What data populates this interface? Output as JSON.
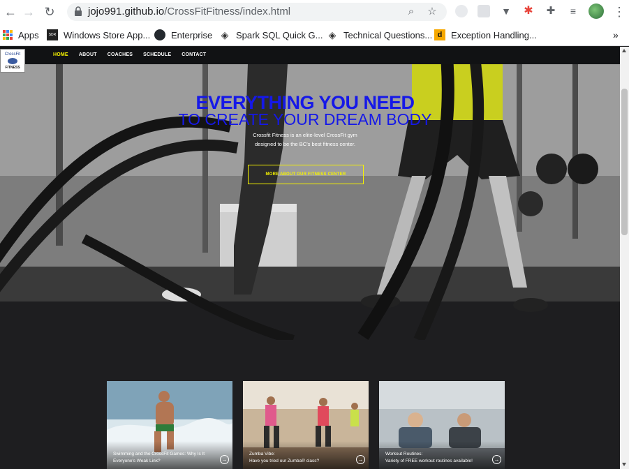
{
  "browser": {
    "url_host": "jojo991.github.io",
    "url_path": "/CrossFitFitness/index.html",
    "bookmarks": [
      {
        "label": "Apps",
        "icon": "apps-grid-icon"
      },
      {
        "label": "Windows Store App...",
        "icon": "sdr-icon"
      },
      {
        "label": "Enterprise",
        "icon": "github-icon"
      },
      {
        "label": "Spark SQL Quick G...",
        "icon": "diamond-icon"
      },
      {
        "label": "Technical Questions...",
        "icon": "diamond-icon"
      },
      {
        "label": "Exception Handling...",
        "icon": "d-icon"
      }
    ],
    "bookmarks_overflow": "»"
  },
  "site": {
    "logo_line1": "CrossFit",
    "logo_line2": "FITNESS",
    "nav": [
      {
        "label": "HOME",
        "active": true
      },
      {
        "label": "ABOUT",
        "active": false
      },
      {
        "label": "COACHES",
        "active": false
      },
      {
        "label": "SCHEDULE",
        "active": false
      },
      {
        "label": "CONTACT",
        "active": false
      }
    ],
    "hero": {
      "title_line1": "EVERYTHING YOU NEED",
      "title_line2": "TO CREATE YOUR DREAM BODY",
      "subtitle_line1": "Crossfit Fitness is an elite-level CrossFit gym",
      "subtitle_line2": "designed to be the BC's best fitness center.",
      "button_label": "MORE ABOUT OUR FITNESS CENTER"
    },
    "cards": [
      {
        "caption_line1": "Swimming and the CrossFit Games: Why Is It",
        "caption_line2": "Everyone's Weak Link?"
      },
      {
        "caption_line1": "Zumba Vibe:",
        "caption_line2": "Have you tried our Zumba® class?"
      },
      {
        "caption_line1": "Workout Routines:",
        "caption_line2": "Variety of FREE workout routines available!"
      }
    ],
    "colors": {
      "accent": "#f6f300",
      "title_blue": "#1518e8",
      "nav_bg": "#111214",
      "page_bg": "#1e1e20"
    }
  }
}
